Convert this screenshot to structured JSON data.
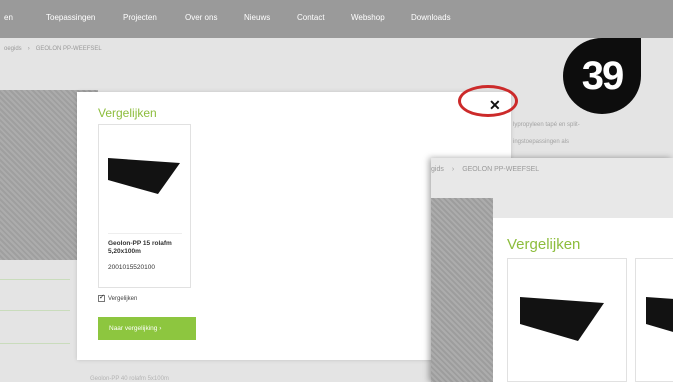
{
  "nav": {
    "items": [
      "en",
      "Toepassingen",
      "Projecten",
      "Over ons",
      "Nieuws",
      "Contact",
      "Webshop",
      "Downloads"
    ]
  },
  "breadcrumb": {
    "parent": "oegids",
    "current": "GEOLON PP-WEEFSEL"
  },
  "background_text": {
    "side_line1": "lypropyleen tapé en split-",
    "side_line2": "ingstoepassingen als",
    "bottom_line": "Geolon-PP 40 rolafm 5x100m"
  },
  "modal": {
    "title": "Vergelijken",
    "close_symbol": "✕",
    "product": {
      "name": "Geolon-PP 15 rolafm 5,20x100m",
      "code": "2001015520100"
    },
    "compare_checkbox_label": "Vergelijken",
    "compare_checked": true,
    "compare_button": "Naar vergelijking ›"
  },
  "zoom_panel": {
    "breadcrumb_parent": "gids",
    "breadcrumb_current": "GEOLON PP-WEEFSEL",
    "modal_title": "Vergelijken"
  },
  "step_badge": "39",
  "colors": {
    "accent_green": "#8dc63f",
    "title_green": "#8dbd3d",
    "highlight_red": "#cc2a2a",
    "nav_gray": "#9a9a9a"
  }
}
